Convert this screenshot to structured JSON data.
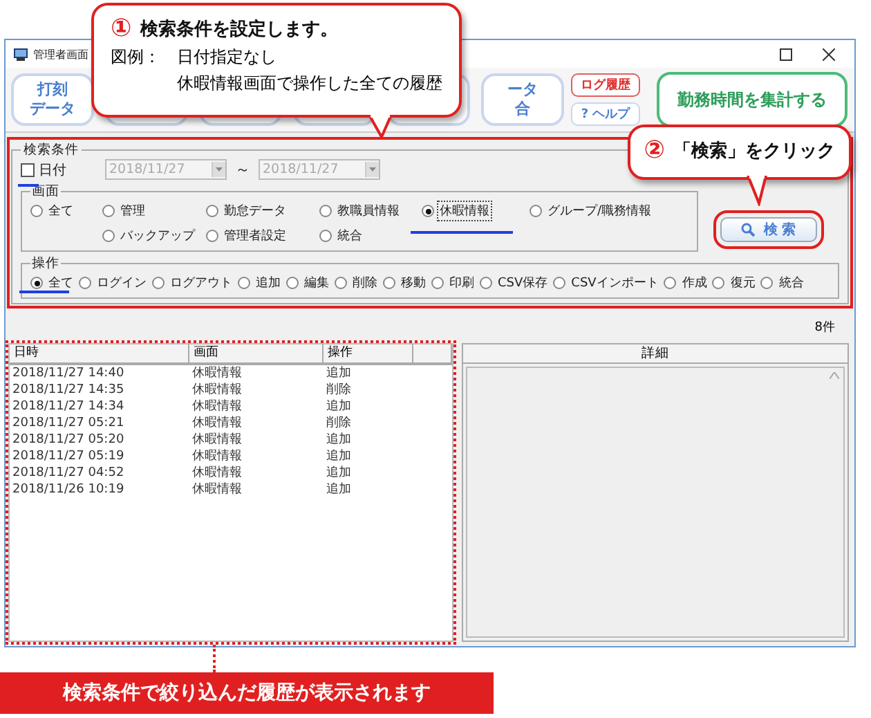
{
  "window": {
    "title": "管理者画面"
  },
  "toolbar": {
    "buttons": [
      {
        "kind": "label",
        "lines": [
          "打刻",
          "データ"
        ]
      },
      {
        "kind": "hidden"
      },
      {
        "kind": "hidden"
      },
      {
        "kind": "hidden"
      },
      {
        "kind": "hidden"
      },
      {
        "kind": "label",
        "lines": [
          "ータ",
          "合"
        ]
      }
    ],
    "log_button": "ログ履歴",
    "help_button": "? ヘルプ",
    "total_button": "勤務時間を集計する"
  },
  "search": {
    "title": "検索条件",
    "date_checkbox": {
      "label": "日付",
      "checked": false
    },
    "date_from": "2018/11/27",
    "range_sep": "～",
    "date_to": "2018/11/27",
    "screen_group": {
      "title": "画面",
      "options": [
        {
          "label": "全て",
          "selected": false
        },
        {
          "label": "管理",
          "selected": false
        },
        {
          "label": "勤怠データ",
          "selected": false
        },
        {
          "label": "教職員情報",
          "selected": false
        },
        {
          "label": "休暇情報",
          "selected": true
        },
        {
          "label": "グループ/職務情報",
          "selected": false
        },
        {
          "label": "バックアップ",
          "selected": false
        },
        {
          "label": "管理者設定",
          "selected": false
        },
        {
          "label": "統合",
          "selected": false
        }
      ]
    },
    "operation_group": {
      "title": "操作",
      "options": [
        {
          "label": "全て",
          "selected": true
        },
        {
          "label": "ログイン",
          "selected": false
        },
        {
          "label": "ログアウト",
          "selected": false
        },
        {
          "label": "追加",
          "selected": false
        },
        {
          "label": "編集",
          "selected": false
        },
        {
          "label": "削除",
          "selected": false
        },
        {
          "label": "移動",
          "selected": false
        },
        {
          "label": "印刷",
          "selected": false
        },
        {
          "label": "CSV保存",
          "selected": false
        },
        {
          "label": "CSVインポート",
          "selected": false
        },
        {
          "label": "作成",
          "selected": false
        },
        {
          "label": "復元",
          "selected": false
        },
        {
          "label": "統合",
          "selected": false
        }
      ]
    },
    "search_button": "検 索"
  },
  "count": "8件",
  "table": {
    "columns": [
      "日時",
      "画面",
      "操作"
    ],
    "rows": [
      [
        "2018/11/27 14:40",
        "休暇情報",
        "追加"
      ],
      [
        "2018/11/27 14:35",
        "休暇情報",
        "削除"
      ],
      [
        "2018/11/27 14:34",
        "休暇情報",
        "追加"
      ],
      [
        "2018/11/27 05:21",
        "休暇情報",
        "削除"
      ],
      [
        "2018/11/27 05:20",
        "休暇情報",
        "追加"
      ],
      [
        "2018/11/27 05:19",
        "休暇情報",
        "追加"
      ],
      [
        "2018/11/27 04:52",
        "休暇情報",
        "追加"
      ],
      [
        "2018/11/26 10:19",
        "休暇情報",
        "追加"
      ]
    ]
  },
  "detail": {
    "title": "詳細"
  },
  "callouts": [
    {
      "number": "①",
      "heading": "検索条件を設定します。",
      "lines": [
        {
          "label": "図例：",
          "text": "日付指定なし"
        },
        {
          "text": "休暇情報画面で操作した全ての履歴"
        }
      ]
    },
    {
      "number": "②",
      "heading": "「検索」をクリック"
    }
  ],
  "footer_note": "検索条件で絞り込んだ履歴が表示されます"
}
